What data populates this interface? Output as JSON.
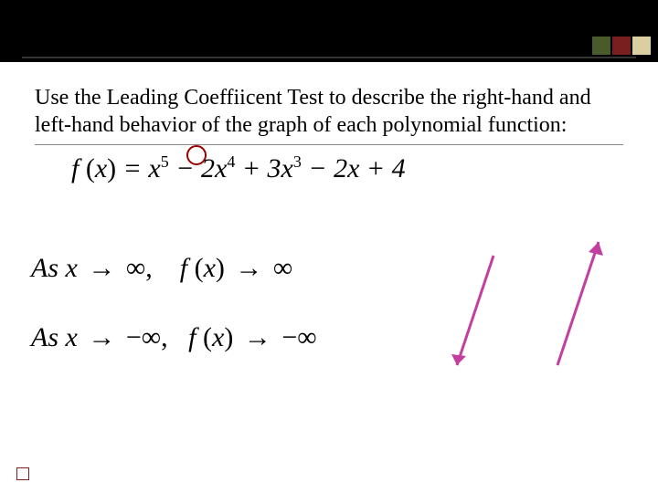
{
  "header": {
    "accent_colors": [
      "#4a5a2a",
      "#7a1f1f",
      "#d9cfa0"
    ]
  },
  "question": {
    "text": "Use the Leading Coeffiicent Test to describe the right-hand and left-hand behavior of the graph of each polynomial function:"
  },
  "polynomial": {
    "lhs": "f (x) =",
    "terms": "x⁵ − 2x⁴ + 3x³ − 2x + 4",
    "circled_exponent": "5"
  },
  "end_behavior": {
    "line1_prefix": "As x",
    "line1_x_to": "∞,",
    "line1_f": "f (x)",
    "line1_f_to": "∞",
    "line2_prefix": "As x",
    "line2_x_to": "−∞,",
    "line2_f": "f (x)",
    "line2_f_to": "−∞"
  },
  "annotations": {
    "circle_color": "#9b0000",
    "arrow_color_left": "#c23fa0",
    "arrow_color_right": "#c23fa0"
  }
}
